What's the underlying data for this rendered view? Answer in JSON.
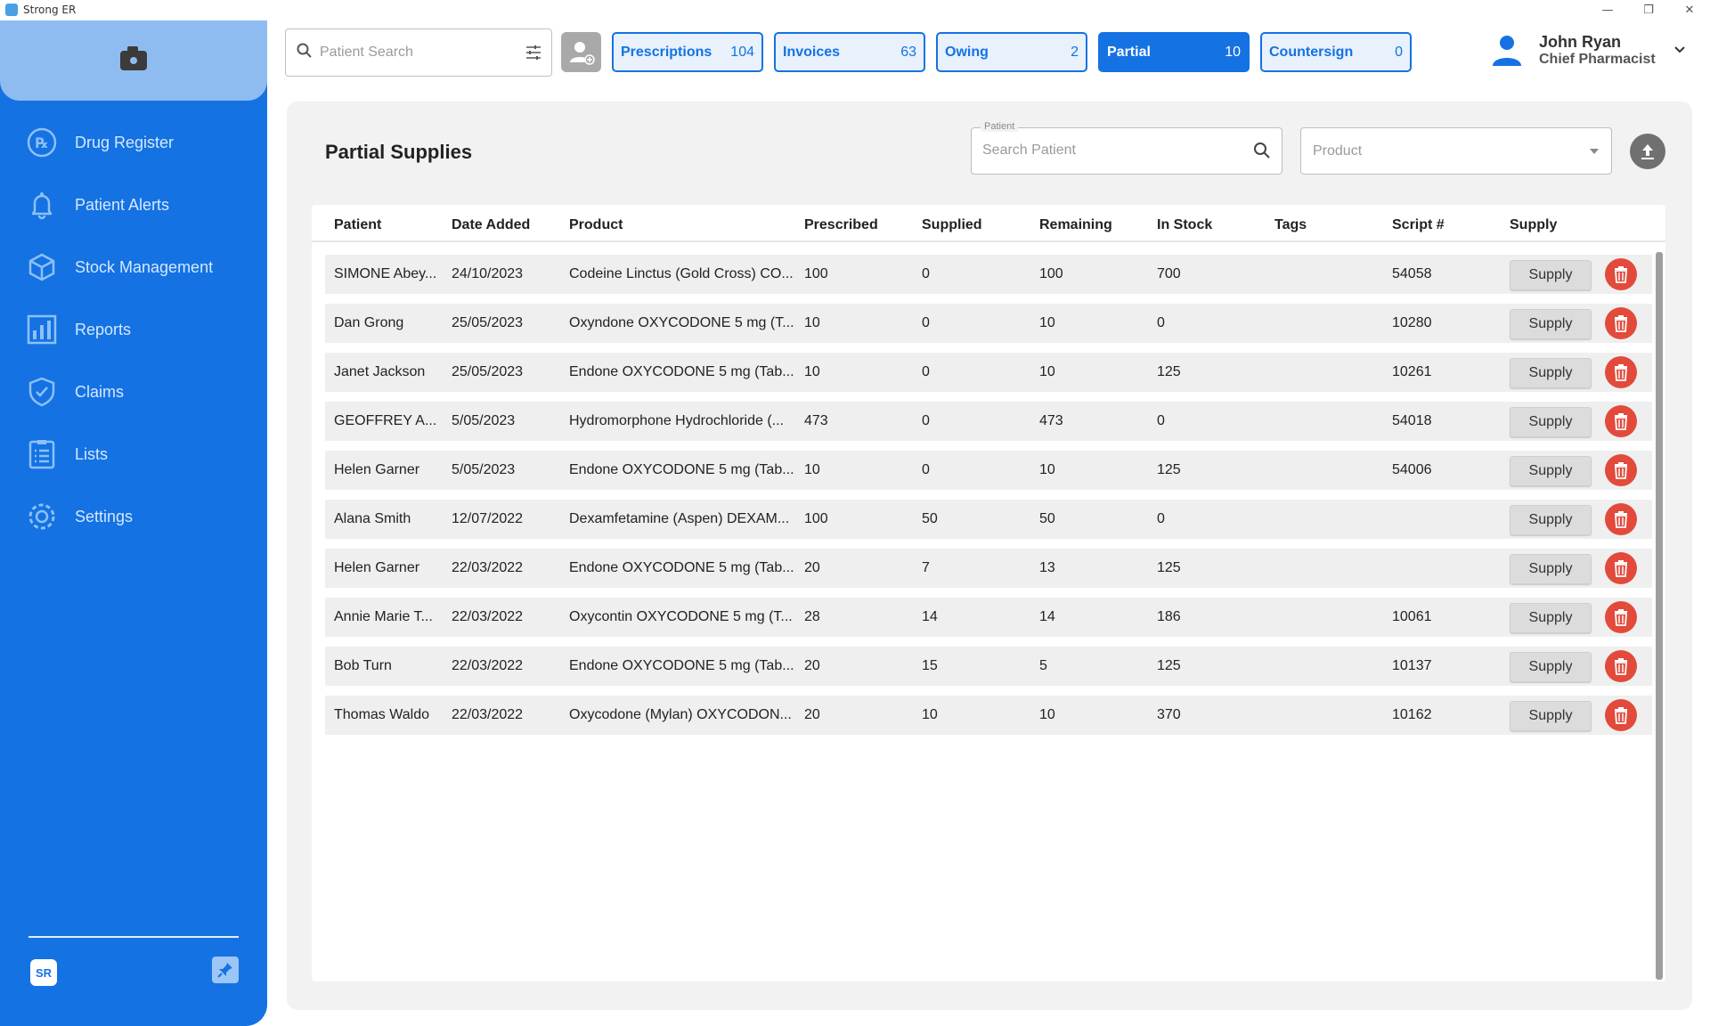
{
  "window": {
    "title": "Strong ER",
    "controls": [
      "—",
      "❐",
      "✕"
    ]
  },
  "sidebar": {
    "items": [
      {
        "label": "Drug Register",
        "icon": "rx-icon"
      },
      {
        "label": "Patient Alerts",
        "icon": "bell-icon"
      },
      {
        "label": "Stock Management",
        "icon": "box-icon"
      },
      {
        "label": "Reports",
        "icon": "bar-chart-icon"
      },
      {
        "label": "Claims",
        "icon": "shield-check-icon"
      },
      {
        "label": "Lists",
        "icon": "checklist-icon"
      },
      {
        "label": "Settings",
        "icon": "gear-icon"
      }
    ],
    "logo_text": "SR"
  },
  "header": {
    "search_placeholder": "Patient Search",
    "tabs": [
      {
        "label": "Prescriptions",
        "count": "104",
        "active": false
      },
      {
        "label": "Invoices",
        "count": "63",
        "active": false
      },
      {
        "label": "Owing",
        "count": "2",
        "active": false
      },
      {
        "label": "Partial",
        "count": "10",
        "active": true
      },
      {
        "label": "Countersign",
        "count": "0",
        "active": false
      }
    ],
    "user": {
      "name": "John Ryan",
      "role": "Chief Pharmacist"
    }
  },
  "main": {
    "title": "Partial Supplies",
    "patient_filter": {
      "label": "Patient",
      "placeholder": "Search Patient"
    },
    "product_filter": {
      "placeholder": "Product"
    },
    "columns": [
      "Patient",
      "Date Added",
      "Product",
      "Prescribed",
      "Supplied",
      "Remaining",
      "In Stock",
      "Tags",
      "Script #",
      "Supply"
    ],
    "supply_label": "Supply",
    "rows": [
      {
        "patient": "SIMONE Abey...",
        "date": "24/10/2023",
        "product": "Codeine Linctus (Gold Cross) CO...",
        "prescribed": "100",
        "supplied": "0",
        "remaining": "100",
        "in_stock": "700",
        "tags": "",
        "script": "54058"
      },
      {
        "patient": "Dan Grong",
        "date": "25/05/2023",
        "product": "Oxyndone OXYCODONE 5 mg (T...",
        "prescribed": "10",
        "supplied": "0",
        "remaining": "10",
        "in_stock": "0",
        "tags": "",
        "script": "10280"
      },
      {
        "patient": "Janet Jackson",
        "date": "25/05/2023",
        "product": "Endone OXYCODONE 5 mg (Tab...",
        "prescribed": "10",
        "supplied": "0",
        "remaining": "10",
        "in_stock": "125",
        "tags": "",
        "script": "10261"
      },
      {
        "patient": "GEOFFREY A...",
        "date": "5/05/2023",
        "product": "Hydromorphone Hydrochloride (...",
        "prescribed": "473",
        "supplied": "0",
        "remaining": "473",
        "in_stock": "0",
        "tags": "",
        "script": "54018"
      },
      {
        "patient": "Helen Garner",
        "date": "5/05/2023",
        "product": "Endone OXYCODONE 5 mg (Tab...",
        "prescribed": "10",
        "supplied": "0",
        "remaining": "10",
        "in_stock": "125",
        "tags": "",
        "script": "54006"
      },
      {
        "patient": "Alana Smith",
        "date": "12/07/2022",
        "product": "Dexamfetamine (Aspen) DEXAM...",
        "prescribed": "100",
        "supplied": "50",
        "remaining": "50",
        "in_stock": "0",
        "tags": "",
        "script": ""
      },
      {
        "patient": "Helen Garner",
        "date": "22/03/2022",
        "product": "Endone OXYCODONE 5 mg (Tab...",
        "prescribed": "20",
        "supplied": "7",
        "remaining": "13",
        "in_stock": "125",
        "tags": "",
        "script": ""
      },
      {
        "patient": "Annie Marie T...",
        "date": "22/03/2022",
        "product": "Oxycontin OXYCODONE 5 mg (T...",
        "prescribed": "28",
        "supplied": "14",
        "remaining": "14",
        "in_stock": "186",
        "tags": "",
        "script": "10061"
      },
      {
        "patient": "Bob Turn",
        "date": "22/03/2022",
        "product": "Endone OXYCODONE 5 mg (Tab...",
        "prescribed": "20",
        "supplied": "15",
        "remaining": "5",
        "in_stock": "125",
        "tags": "",
        "script": "10137"
      },
      {
        "patient": "Thomas Waldo",
        "date": "22/03/2022",
        "product": "Oxycodone (Mylan) OXYCODON...",
        "prescribed": "20",
        "supplied": "10",
        "remaining": "10",
        "in_stock": "370",
        "tags": "",
        "script": "10162"
      }
    ]
  },
  "colors": {
    "primary": "#1472e3",
    "sidebar_top": "#8fbcf0",
    "delete": "#e24a3b",
    "panel": "#f2f2f2"
  }
}
